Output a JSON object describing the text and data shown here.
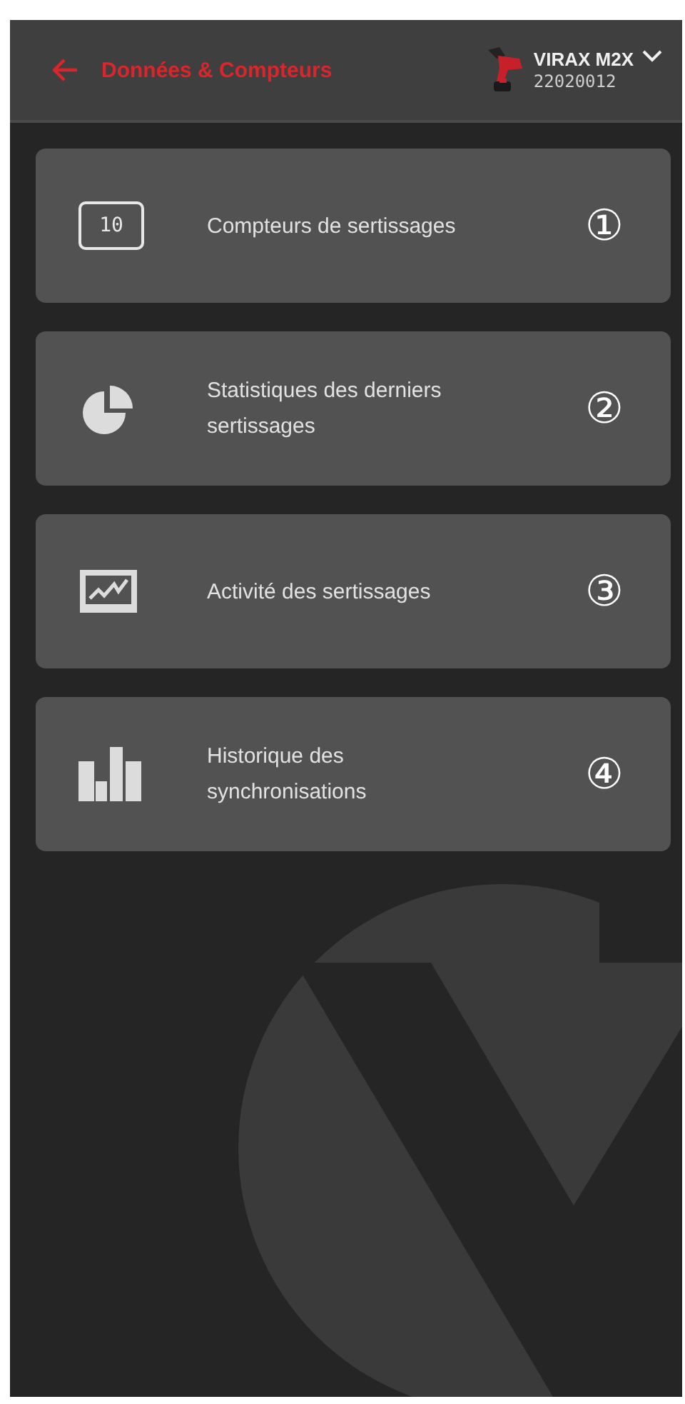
{
  "header": {
    "title": "Données & Compteurs",
    "device": {
      "name": "VIRAX M2X",
      "serial": "22020012"
    }
  },
  "menu": [
    {
      "kind": "counter",
      "icon_text": "10",
      "label": "Compteurs de sertissages",
      "marker": "①"
    },
    {
      "kind": "pie",
      "label": "Statistiques des derniers sertissages",
      "marker": "②"
    },
    {
      "kind": "activity",
      "label": "Activité des sertissages",
      "marker": "③"
    },
    {
      "kind": "bars",
      "label": "Historique des synchronisations",
      "marker": "④"
    }
  ]
}
